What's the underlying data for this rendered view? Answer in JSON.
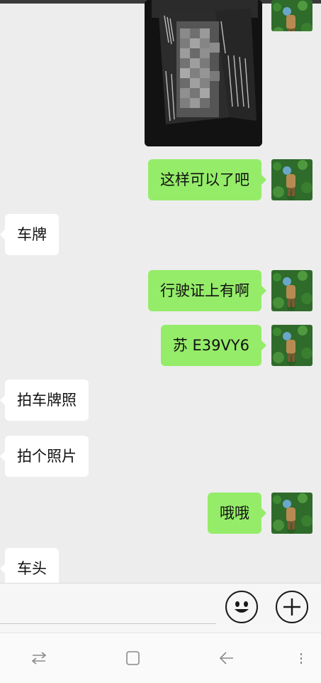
{
  "conversation": {
    "messages": [
      {
        "side": "out",
        "type": "image",
        "blurred": true
      },
      {
        "side": "out",
        "type": "text",
        "text": "这样可以了吧"
      },
      {
        "side": "in",
        "type": "text",
        "text": "车牌"
      },
      {
        "side": "out",
        "type": "text",
        "text": "行驶证上有啊"
      },
      {
        "side": "out",
        "type": "text",
        "text": "苏 E39VY6"
      },
      {
        "side": "in",
        "type": "text",
        "text": "拍车牌照"
      },
      {
        "side": "in",
        "type": "text",
        "text": "拍个照片"
      },
      {
        "side": "out",
        "type": "text",
        "text": "哦哦"
      },
      {
        "side": "in",
        "type": "text",
        "text": "车头"
      }
    ]
  },
  "input_bar": {
    "value": "",
    "emoji_icon": "smiley-face-icon",
    "plus_icon": "plus-icon"
  },
  "system_nav": {
    "icons": [
      "recent-apps-icon",
      "home-icon",
      "back-icon",
      "menu-icon"
    ]
  },
  "colors": {
    "outgoing_bubble": "#95ec69",
    "incoming_bubble": "#ffffff",
    "chat_background": "#ededed"
  }
}
